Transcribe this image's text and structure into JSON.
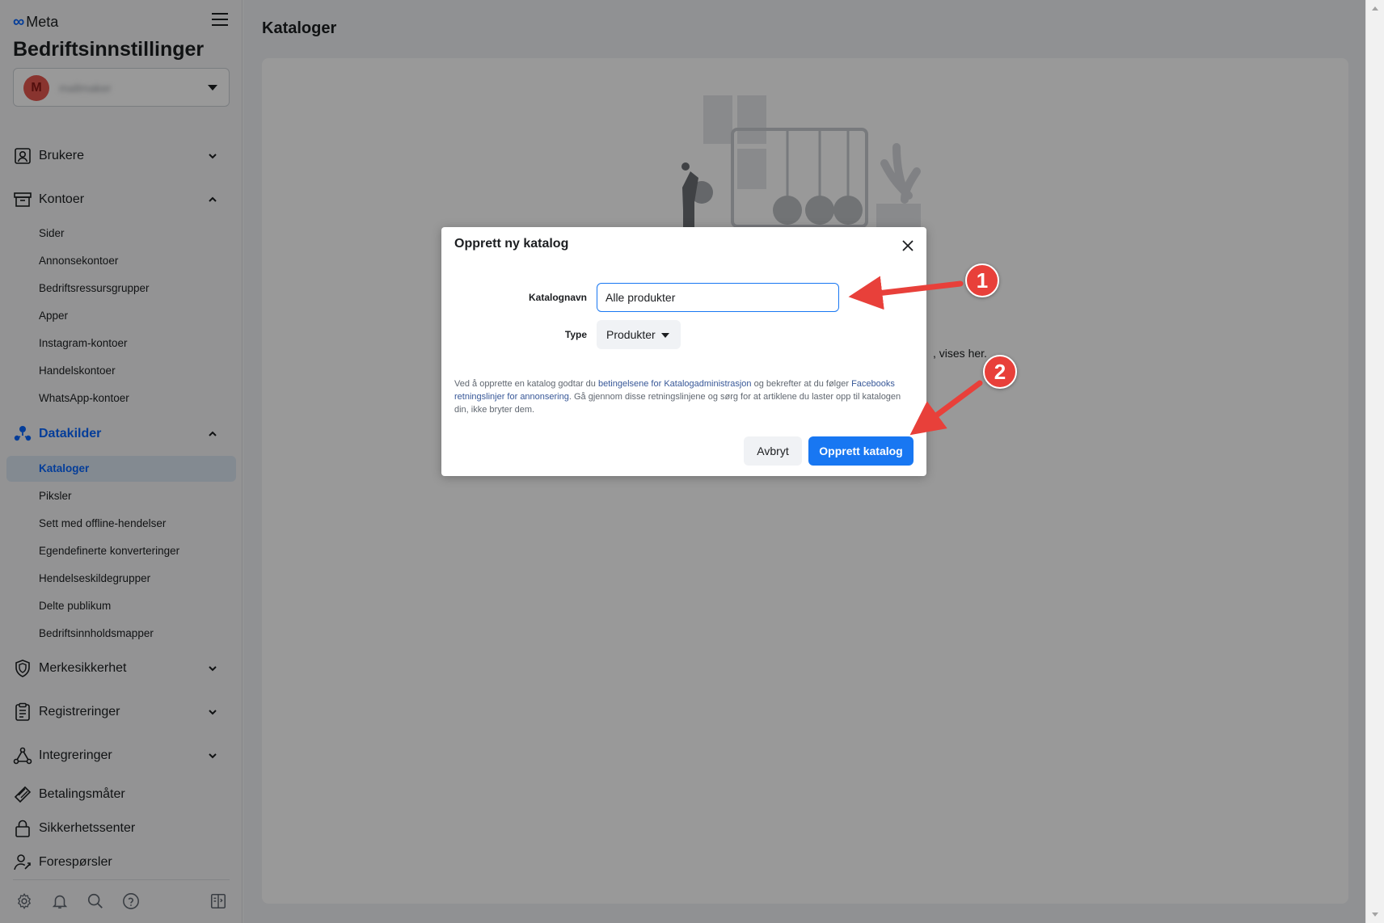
{
  "app": {
    "brand": "Meta",
    "title": "Bedriftsinnstillinger",
    "business": {
      "avatar_letter": "M",
      "name": "mallmaker"
    }
  },
  "sidebar": {
    "sections": [
      {
        "label": "Brukere",
        "icon": "users-icon",
        "expanded": false
      },
      {
        "label": "Kontoer",
        "icon": "accounts-icon",
        "expanded": true,
        "items": [
          "Sider",
          "Annonsekontoer",
          "Bedriftsressursgrupper",
          "Apper",
          "Instagram-kontoer",
          "Handelskontoer",
          "WhatsApp-kontoer"
        ]
      },
      {
        "label": "Datakilder",
        "icon": "data-sources-icon",
        "expanded": true,
        "active": true,
        "items": [
          "Kataloger",
          "Piksler",
          "Sett med offline-hendelser",
          "Egendefinerte konverteringer",
          "Hendelseskildegrupper",
          "Delte publikum",
          "Bedriftsinnholdsmapper"
        ],
        "active_item": "Kataloger"
      },
      {
        "label": "Merkesikkerhet",
        "icon": "shield-icon",
        "expanded": false
      },
      {
        "label": "Registreringer",
        "icon": "clipboard-icon",
        "expanded": false
      },
      {
        "label": "Integreringer",
        "icon": "integrations-icon",
        "expanded": false
      },
      {
        "label": "Betalingsmåter",
        "icon": "payment-icon"
      },
      {
        "label": "Sikkerhetssenter",
        "icon": "lock-icon"
      },
      {
        "label": "Forespørsler",
        "icon": "requests-icon"
      }
    ],
    "footer_icons": [
      "gear-icon",
      "bell-icon",
      "search-icon",
      "help-icon",
      "panel-toggle-icon"
    ]
  },
  "main": {
    "title": "Kataloger",
    "hint_text": ", vises her."
  },
  "dialog": {
    "title": "Opprett ny katalog",
    "name_label": "Katalognavn",
    "name_value": "Alle produkter",
    "type_label": "Type",
    "type_value": "Produkter",
    "terms_part1": "Ved å opprette en katalog godtar du ",
    "terms_link1": "betingelsene for Katalogadministrasjon",
    "terms_part2": " og bekrefter at du følger ",
    "terms_link2": "Facebooks retningslinjer for annonsering",
    "terms_part3": ". Gå gjennom disse retningslinjene og sørg for at artiklene du laster opp til katalogen din, ikke bryter dem.",
    "cancel_label": "Avbryt",
    "create_label": "Opprett katalog"
  },
  "annotations": {
    "badge1": "1",
    "badge2": "2",
    "color": "#e8403a"
  }
}
